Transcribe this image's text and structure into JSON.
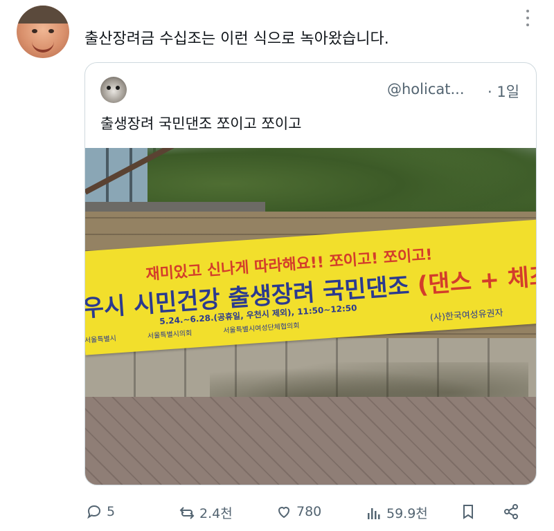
{
  "post": {
    "text": "출산장려금 수십조는 이런 식으로 녹아왔습니다."
  },
  "quoted": {
    "handle": "@holicat...",
    "time": "· 1일",
    "text": "출생장려 국민댄조 쪼이고 쪼이고",
    "image": {
      "banner_line1": "재미있고 신나게 따라해요!! 쪼이고! 쪼이고!",
      "banner_line2_blue": "우시 시민건강 출생장려 국민댄조",
      "banner_line2_red": "(댄스 + 체조)",
      "banner_date": "5.24.~6.28.(공휴일, 우천시 제외), 11:50~12:50",
      "banner_logos": [
        "서울특별시",
        "서울특별시의회",
        "서울특별시여성단체협의회"
      ],
      "banner_org": "(사)한국여성유권자"
    }
  },
  "actions": {
    "replies": "5",
    "reposts": "2.4천",
    "likes": "780",
    "views": "59.9천"
  },
  "colors": {
    "text_primary": "#0f1419",
    "text_secondary": "#536471",
    "border": "#cfd9de",
    "banner_yellow": "#f2df2c",
    "banner_red": "#d33d2b",
    "banner_blue": "#2b3a8f"
  }
}
